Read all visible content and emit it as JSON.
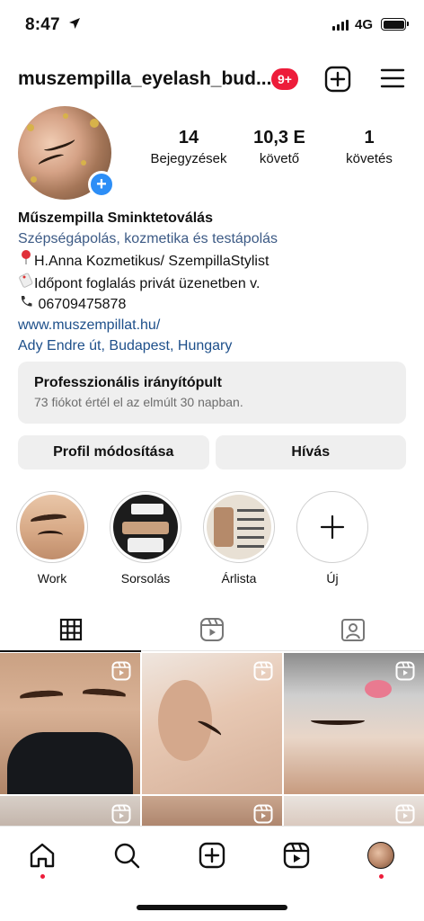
{
  "status_bar": {
    "time": "8:47",
    "network": "4G"
  },
  "header": {
    "username": "muszempilla_eyelash_bud...",
    "notification_badge": "9+",
    "create_icon": "plus-square-icon",
    "menu_icon": "hamburger-menu-icon"
  },
  "profile": {
    "stats": [
      {
        "value": "14",
        "label": "Bejegyzések"
      },
      {
        "value": "10,3 E",
        "label": "követő"
      },
      {
        "value": "1",
        "label": "követés"
      }
    ],
    "bio": {
      "name": "Műszempilla Sminktetoválás",
      "category": "Szépségápolás, kozmetika és testápolás",
      "line1": "H.Anna Kozmetikus/ SzempillaStylist",
      "line2": "Időpont foglalás privát üzenetben v.",
      "line3": "06709475878",
      "website": "www.muszempillat.hu/",
      "location": "Ady Endre út, Budapest, Hungary"
    }
  },
  "dashboard": {
    "title": "Professzionális irányítópult",
    "subtitle": "73 fiókot értél el az elmúlt 30 napban."
  },
  "buttons": {
    "edit_profile": "Profil módosítása",
    "call": "Hívás"
  },
  "highlights": [
    {
      "label": "Work"
    },
    {
      "label": "Sorsolás"
    },
    {
      "label": "Árlista"
    },
    {
      "label": "Új"
    }
  ],
  "colors": {
    "badge": "#ed1c3a",
    "add_button": "#2d8ef6",
    "link": "#1d4f8a",
    "panel_bg": "#efefef"
  }
}
